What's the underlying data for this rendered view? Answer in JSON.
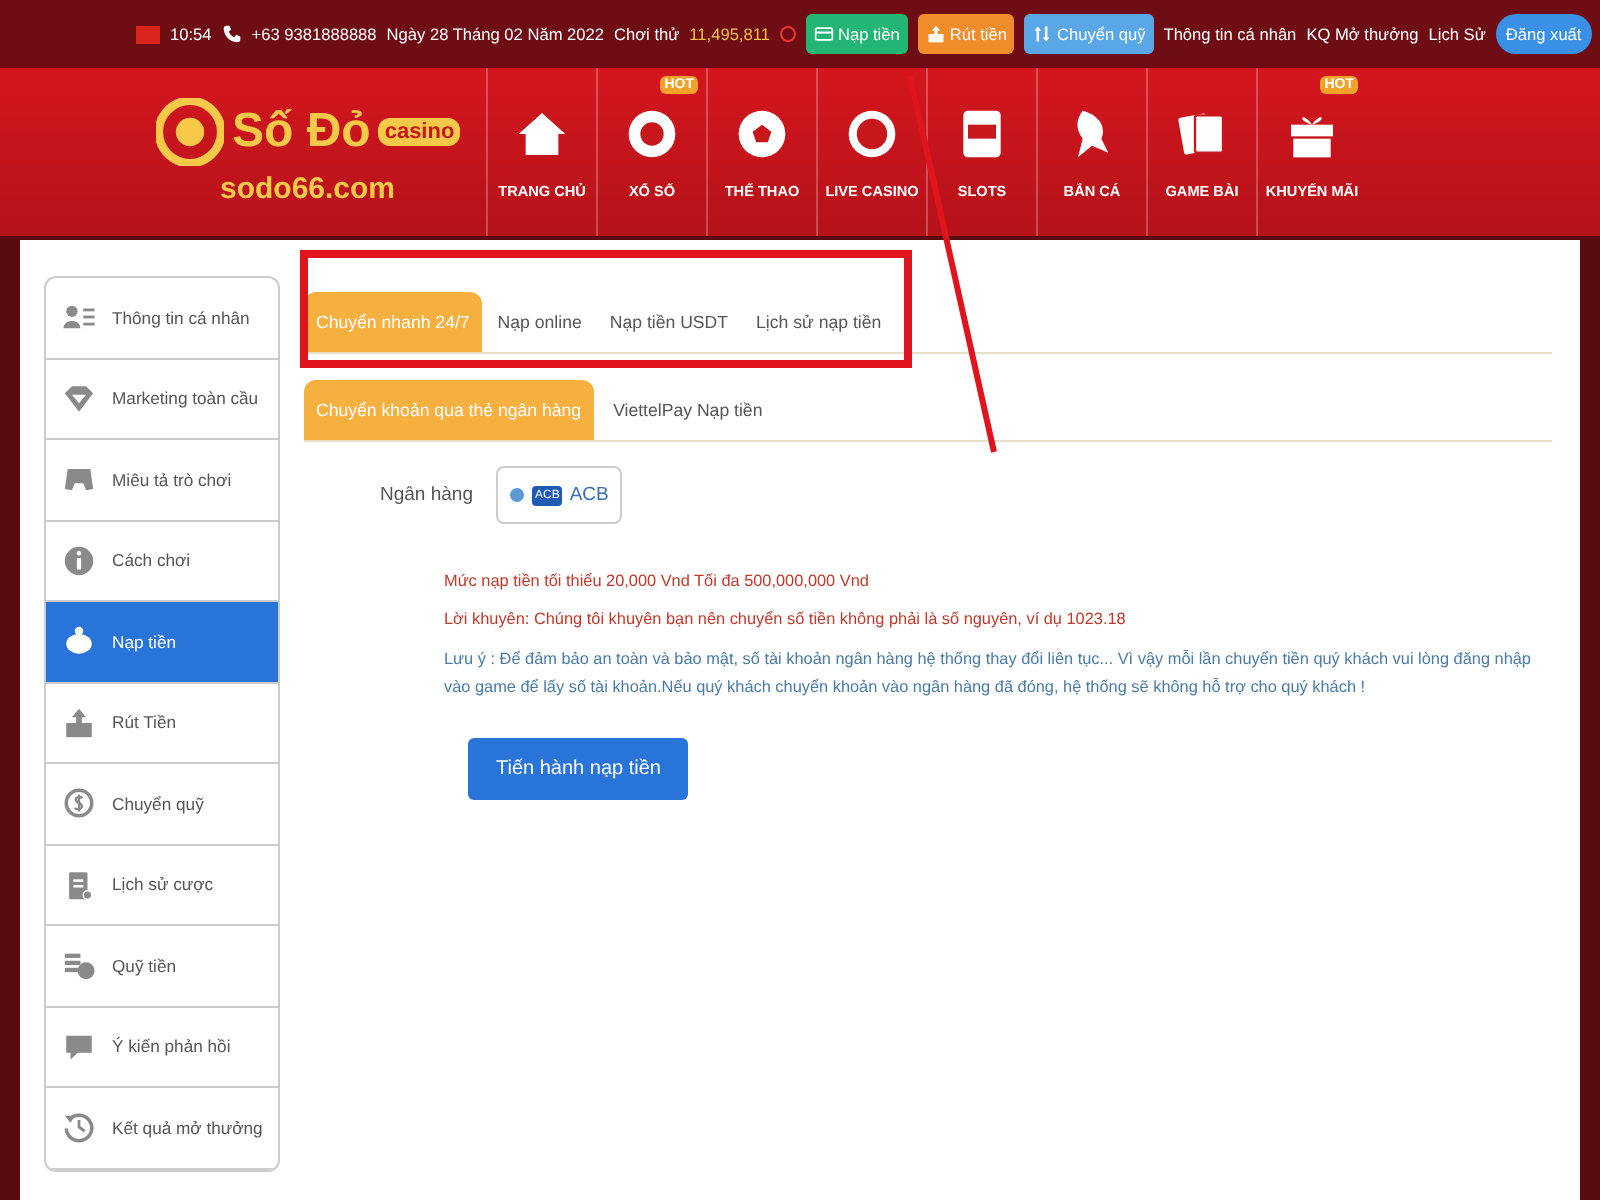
{
  "top_bar": {
    "time": "10:54",
    "phone": "+63 9381888888",
    "date": "Ngày 28 Tháng 02 Năm 2022",
    "trial_label": "Chơi thử",
    "balance": "11,495,811",
    "buttons": [
      {
        "label": "Nạp tiền",
        "color": "#22b573"
      },
      {
        "label": "Rút tiền",
        "color": "#f08c2a"
      },
      {
        "label": "Chuyển quỹ",
        "color": "#5aa7e8"
      }
    ],
    "links": [
      "Thông tin cá nhân",
      "KQ Mở thưởng",
      "Lịch Sử"
    ],
    "logout": "Đăng xuất"
  },
  "logo": {
    "name": "Số Đỏ",
    "badge": "casino",
    "domain": "sodo66.com"
  },
  "nav": [
    {
      "label": "TRANG CHỦ"
    },
    {
      "label": "XỔ SỐ",
      "badge": "HOT"
    },
    {
      "label": "THỂ THAO"
    },
    {
      "label": "LIVE CASINO"
    },
    {
      "label": "SLOTS"
    },
    {
      "label": "BẮN CÁ"
    },
    {
      "label": "GAME BÀI"
    },
    {
      "label": "KHUYẾN MÃI",
      "badge": "HOT"
    }
  ],
  "sidebar": [
    {
      "label": "Thông tin cá nhân",
      "selected": false
    },
    {
      "label": "Marketing toàn cầu",
      "selected": false
    },
    {
      "label": "Miêu tả trò chơi",
      "selected": false
    },
    {
      "label": "Cách chơi",
      "selected": false
    },
    {
      "label": "Nạp tiền",
      "selected": true
    },
    {
      "label": "Rút Tiền",
      "selected": false
    },
    {
      "label": "Chuyển quỹ",
      "selected": false
    },
    {
      "label": "Lịch sử cược",
      "selected": false
    },
    {
      "label": "Quỹ tiền",
      "selected": false
    },
    {
      "label": "Ý kiến phản hồi",
      "selected": false
    },
    {
      "label": "Kết quả mở thưởng",
      "selected": false
    }
  ],
  "tabs": [
    {
      "label": "Chuyển nhanh 24/7",
      "selected": true
    },
    {
      "label": "Nạp online",
      "selected": false
    },
    {
      "label": "Nạp tiền USDT",
      "selected": false
    },
    {
      "label": "Lịch sử nạp tiền",
      "selected": false
    }
  ],
  "subtabs": [
    {
      "label": "Chuyển khoản qua thẻ ngân hàng",
      "selected": true
    },
    {
      "label": "ViettelPay Nạp tiền",
      "selected": false
    }
  ],
  "bank": {
    "label": "Ngân hàng",
    "option": {
      "logo": "ACB",
      "name": "ACB",
      "selected": true
    }
  },
  "notes": [
    {
      "kind": "warning",
      "text": "Mức nạp tiền tối thiểu 20,000 Vnd Tối đa 500,000,000 Vnd"
    },
    {
      "kind": "warning",
      "text": "Lời khuyên: Chúng tôi khuyên bạn nên chuyển số tiền không phải là số nguyên, ví dụ 1023.18"
    },
    {
      "kind": "info",
      "text": "Lưu ý : Để đảm bảo an toàn và bảo mật, số tài khoản ngân hàng hệ thống thay đổi liên tục... Vì vậy mỗi lần chuyển tiền quý khách vui lòng đăng nhập vào game để lấy số tài khoản.Nếu quý khách chuyển khoản vào ngân hàng đã đóng, hệ thống sẽ không hỗ trợ cho quý khách !"
    }
  ],
  "submit": "Tiến hành nạp tiền"
}
